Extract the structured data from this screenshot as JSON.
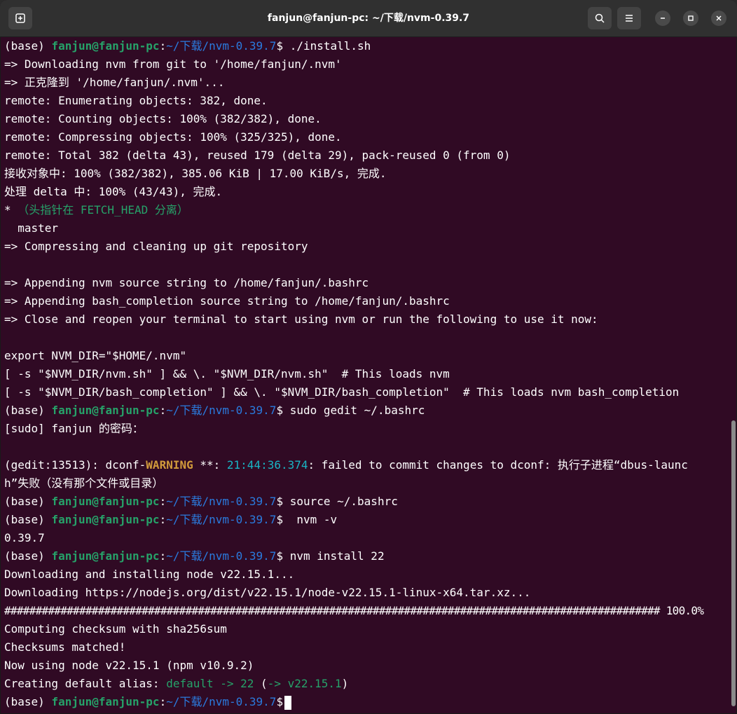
{
  "window": {
    "title": "fanjun@fanjun-pc: ~/下载/nvm-0.39.7",
    "buttons": {
      "new_tab_icon": "new-tab-icon",
      "search_icon": "search-icon",
      "menu_icon": "hamburger-menu-icon",
      "minimize_icon": "minimize-icon",
      "maximize_icon": "maximize-icon",
      "close_icon": "close-icon"
    }
  },
  "prompt": {
    "env": "(base) ",
    "user": "fanjun@fanjun-pc",
    "colon": ":",
    "path": "~/下载/nvm-0.39.7",
    "dollar": "$"
  },
  "lines": {
    "l1_cmd": " ./install.sh",
    "l2": "=> Downloading nvm from git to '/home/fanjun/.nvm'",
    "l3": "=> 正克隆到 '/home/fanjun/.nvm'...",
    "l4": "remote: Enumerating objects: 382, done.",
    "l5": "remote: Counting objects: 100% (382/382), done.",
    "l6": "remote: Compressing objects: 100% (325/325), done.",
    "l7": "remote: Total 382 (delta 43), reused 179 (delta 29), pack-reused 0 (from 0)",
    "l8": "接收对象中: 100% (382/382), 385.06 KiB | 17.00 KiB/s, 完成.",
    "l9": "处理 delta 中: 100% (43/43), 完成.",
    "l10_star": "* ",
    "l10_head": "（头指针在 FETCH_HEAD 分离）",
    "l11": "  master",
    "l12": "=> Compressing and cleaning up git repository",
    "l13": "",
    "l14": "=> Appending nvm source string to /home/fanjun/.bashrc",
    "l15": "=> Appending bash_completion source string to /home/fanjun/.bashrc",
    "l16": "=> Close and reopen your terminal to start using nvm or run the following to use it now:",
    "l17": "",
    "l18": "export NVM_DIR=\"$HOME/.nvm\"",
    "l19": "[ -s \"$NVM_DIR/nvm.sh\" ] && \\. \"$NVM_DIR/nvm.sh\"  # This loads nvm",
    "l20": "[ -s \"$NVM_DIR/bash_completion\" ] && \\. \"$NVM_DIR/bash_completion\"  # This loads nvm bash_completion",
    "l21_cmd": " sudo gedit ~/.bashrc",
    "l22": "[sudo] fanjun 的密码：",
    "l23": "",
    "l24_a": "(gedit:13513): dconf-",
    "l24_warn": "WARNING",
    "l24_b": " **: ",
    "l24_time": "21:44:36.374",
    "l24_c": ": failed to commit changes to dconf: 执行子进程“dbus-launc",
    "l25": "h”失败（没有那个文件或目录）",
    "l26_cmd": " source ~/.bashrc",
    "l27_cmd": "  nvm -v",
    "l28": "0.39.7",
    "l29_cmd": " nvm install 22",
    "l30": "Downloading and installing node v22.15.1...",
    "l31": "Downloading https://nodejs.org/dist/v22.15.1/node-v22.15.1-linux-x64.tar.xz...",
    "l32": "######################################################################################################### 100.0%",
    "l33": "Computing checksum with sha256sum",
    "l34": "Checksums matched!",
    "l35": "Now using node v22.15.1 (npm v10.9.2)",
    "l36_a": "Creating default alias: ",
    "l36_default": "default",
    "l36_arrow1": " -> ",
    "l36_22": "22",
    "l36_paren": " (",
    "l36_arrow2": "->",
    "l36_ver": " v22.15.1",
    "l36_close": ")"
  },
  "colors": {
    "background": "#300a24",
    "prompt_user": "#26a269",
    "prompt_path": "#2a7bde",
    "warning": "#d19a3b",
    "timestamp": "#19b5c5"
  }
}
